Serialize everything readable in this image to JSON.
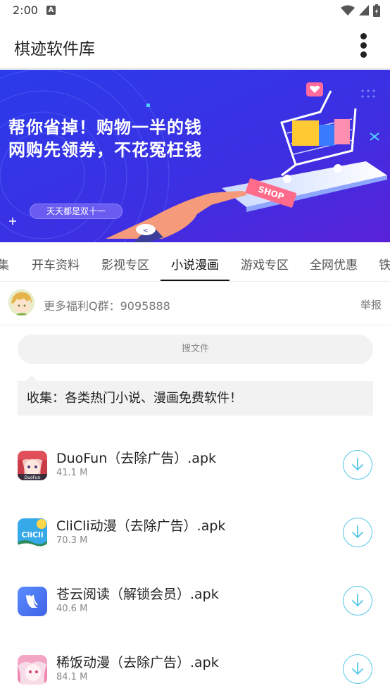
{
  "status_bar": {
    "time": "2:00",
    "notification_icon": "A"
  },
  "app_bar": {
    "title": "棋迹软件库"
  },
  "banner": {
    "line1": "帮你省掉！购物一半的钱",
    "line2": "网购先领券，不花冤枉钱",
    "pill": "天天都是双十一",
    "shop_tag": "SHOP"
  },
  "tabs": [
    {
      "label": "集"
    },
    {
      "label": "开车资料"
    },
    {
      "label": "影视专区"
    },
    {
      "label": "小说漫画",
      "active": true
    },
    {
      "label": "游戏专区"
    },
    {
      "label": "全网优惠"
    },
    {
      "label": "铁"
    }
  ],
  "group": {
    "text": "更多福利Q群：9095888",
    "report": "举报"
  },
  "search": {
    "placeholder": "搜文件"
  },
  "notice": {
    "text": "收集：各类热门小说、漫画免费软件！"
  },
  "files": [
    {
      "name": "DuoFun（去除广告）.apk",
      "size": "41.1 M",
      "icon": "duofun-app-icon",
      "icon_label": "DuoFun"
    },
    {
      "name": "CliCli动漫（去除广告）.apk",
      "size": "70.3 M",
      "icon": "clicli-app-icon",
      "icon_label": "CliCli"
    },
    {
      "name": "苍云阅读（解锁会员）.apk",
      "size": "40.6 M",
      "icon": "cangyun-app-icon"
    },
    {
      "name": "稀饭动漫（去除广告）.apk",
      "size": "84.1 M",
      "icon": "xifan-app-icon"
    }
  ],
  "colors": {
    "accent": "#58c8e8",
    "banner_bg": "#3b2fe6",
    "active_tab": "#111111"
  }
}
